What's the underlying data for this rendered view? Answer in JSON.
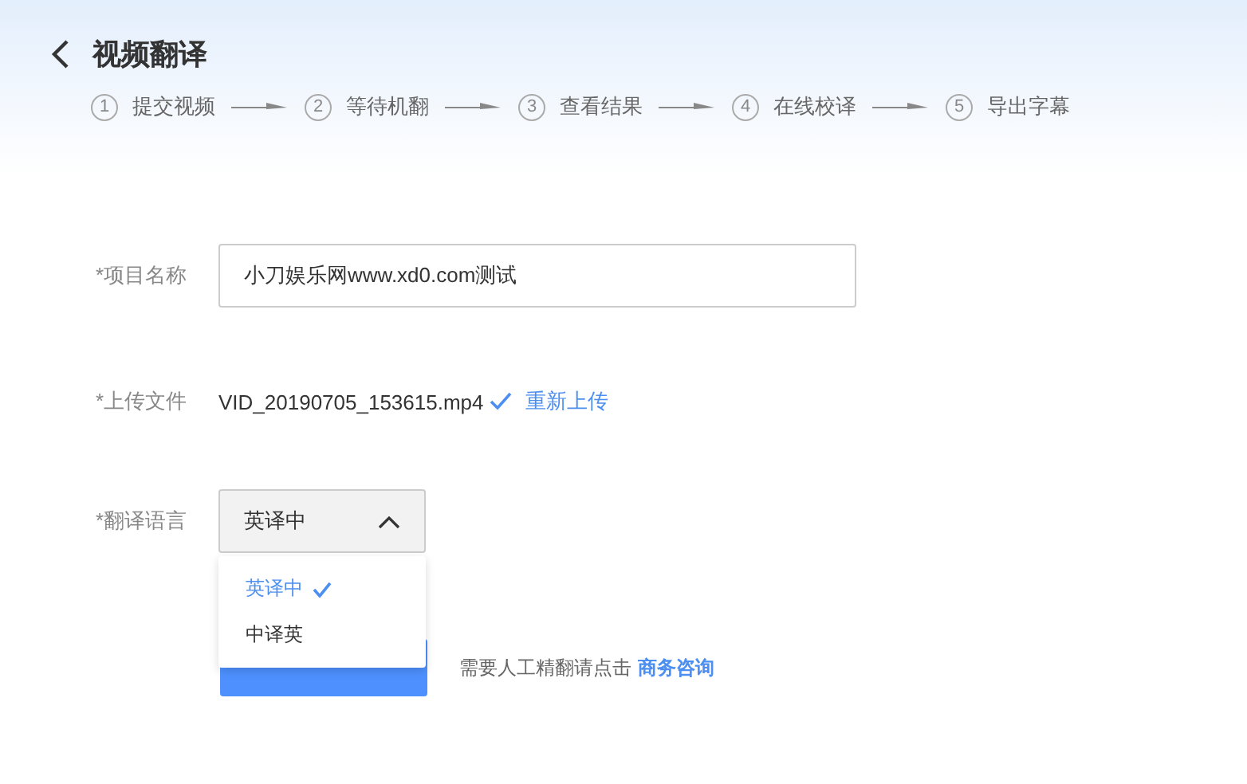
{
  "header": {
    "title": "视频翻译"
  },
  "steps": [
    {
      "number": "1",
      "label": "提交视频"
    },
    {
      "number": "2",
      "label": "等待机翻"
    },
    {
      "number": "3",
      "label": "查看结果"
    },
    {
      "number": "4",
      "label": "在线校译"
    },
    {
      "number": "5",
      "label": "导出字幕"
    }
  ],
  "form": {
    "fields": [
      {
        "kind": "text",
        "label": "*项目名称",
        "value": "小刀娱乐网www.xd0.com测试"
      },
      {
        "kind": "file",
        "label": "*上传文件",
        "file": "VID_20190705_153615.mp4",
        "uploaded": true,
        "action": "重新上传"
      },
      {
        "kind": "select",
        "label": "*翻译语言",
        "value": "英译中",
        "expanded": true,
        "options": [
          {
            "label": "英译中",
            "selected": true
          },
          {
            "label": "中译英",
            "selected": false
          }
        ]
      }
    ],
    "submit": {
      "hint": "需要人工精翻请点击",
      "link": "商务咨询"
    }
  }
}
